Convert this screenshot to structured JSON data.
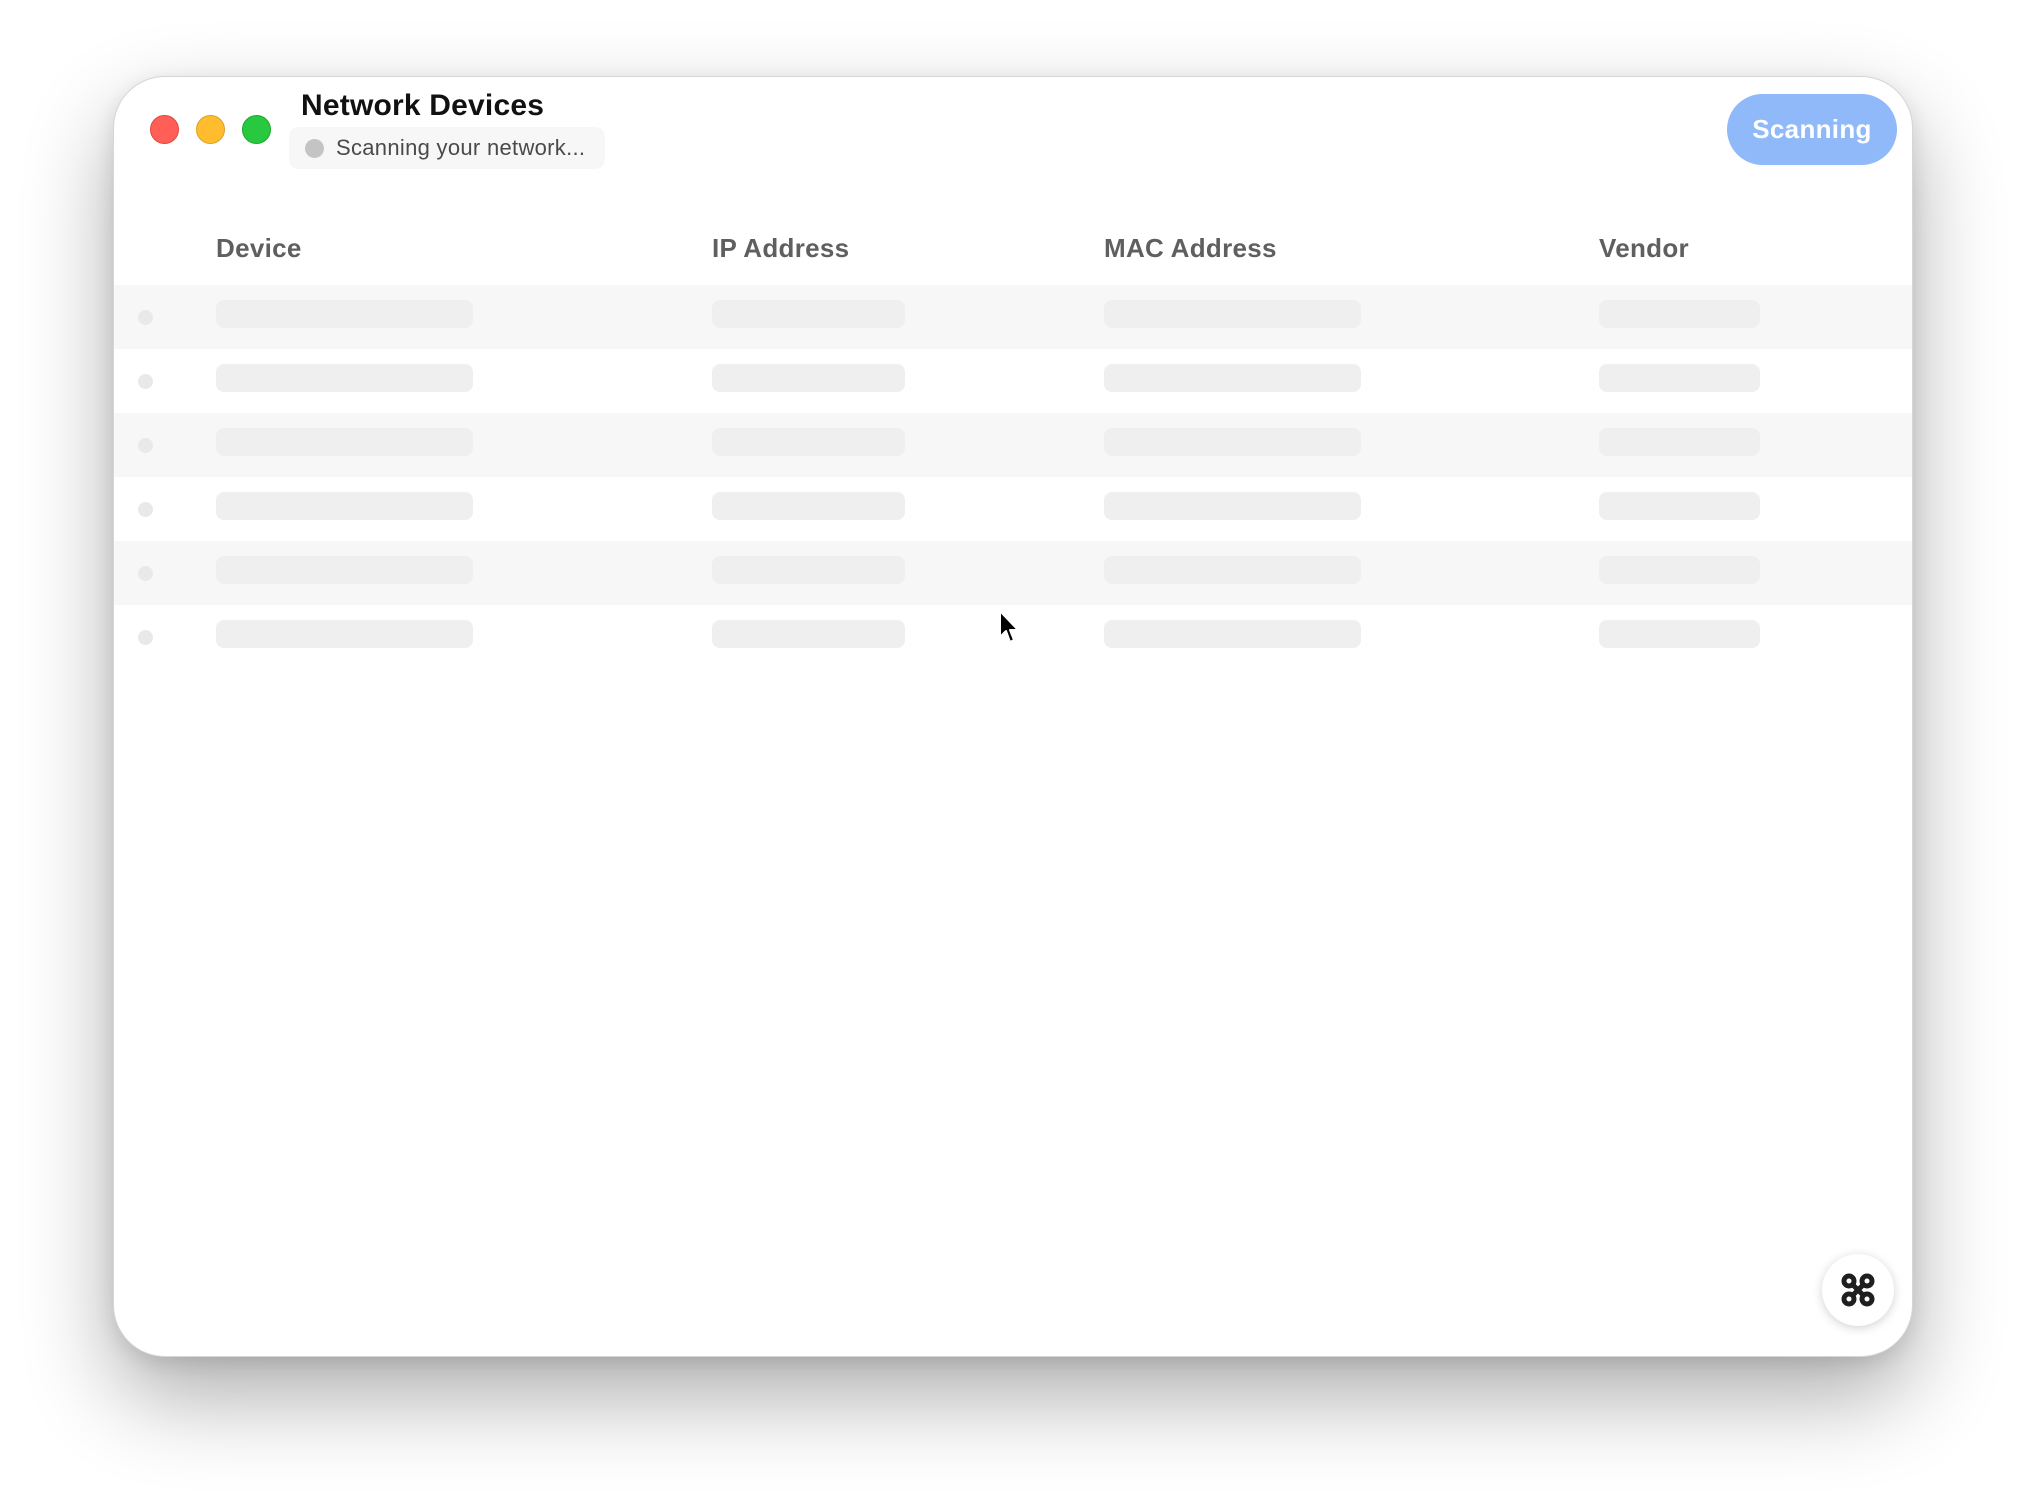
{
  "window": {
    "title": "Network Devices",
    "status_text": "Scanning your network...",
    "scan_button_label": "Scanning"
  },
  "table": {
    "columns": [
      "Device",
      "IP Address",
      "MAC Address",
      "Vendor"
    ],
    "placeholder_row_count": 6,
    "state": "loading-skeleton"
  },
  "icons": {
    "fab": "command-icon",
    "cursor": "pointer-cursor-icon"
  },
  "colors": {
    "close": "#ff5f57",
    "minimize": "#febc2e",
    "zoom": "#28c840",
    "scan_button": "#8fb9f9",
    "status_dot": "#c4c4c4"
  }
}
